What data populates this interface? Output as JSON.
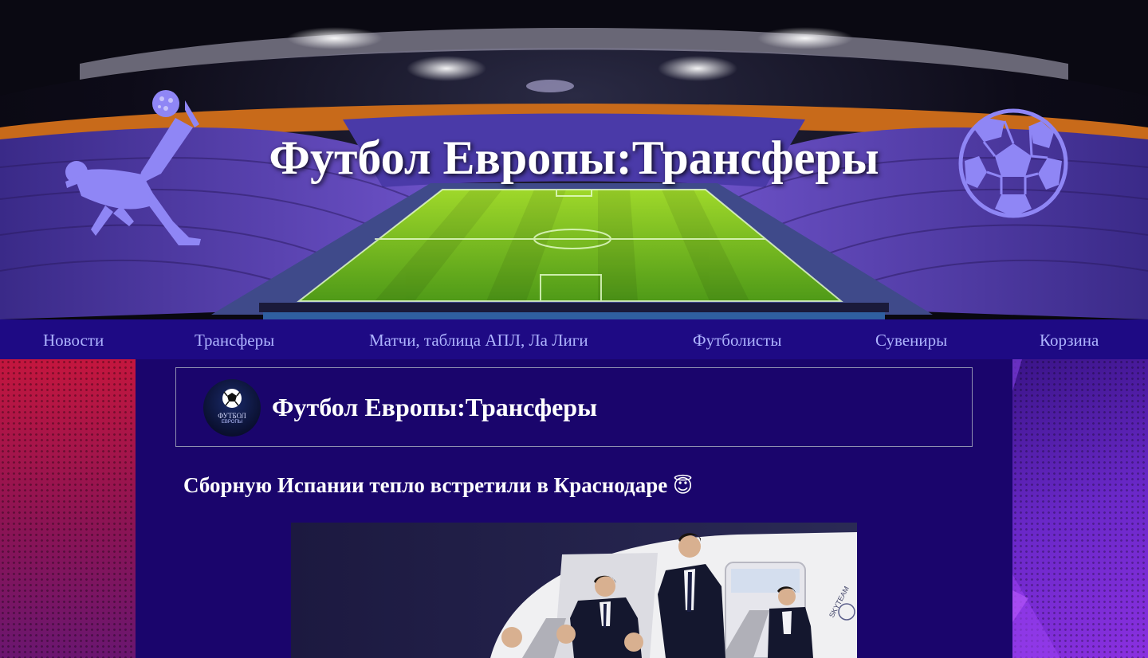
{
  "header": {
    "site_title": "Футбол Европы:Трансферы"
  },
  "nav": {
    "items": [
      {
        "label": "Новости"
      },
      {
        "label": "Трансферы"
      },
      {
        "label": "Матчи, таблица АПЛ, Ла Лиги"
      },
      {
        "label": "Футболисты"
      },
      {
        "label": "Сувениры"
      },
      {
        "label": "Корзина"
      }
    ]
  },
  "brand": {
    "title": "Футбол Европы:Трансферы",
    "logo_text": "ФУТБОЛ",
    "logo_subtext": "ЕВРОПЫ"
  },
  "article": {
    "headline": "Сборную Испании тепло встретили в Краснодаре",
    "headline_emoji": "😇",
    "photo_airline_text": "SKYTEAM"
  },
  "colors": {
    "nav_bg": "#1e0a84",
    "nav_link": "#aeb4ff",
    "main_bg": "#1a056c",
    "accent_icon": "#8f86f5"
  },
  "icons": {
    "header_left": "bicycle-kick-player-icon",
    "header_right": "soccer-ball-icon",
    "brand": "soccer-ball-logo-icon"
  }
}
